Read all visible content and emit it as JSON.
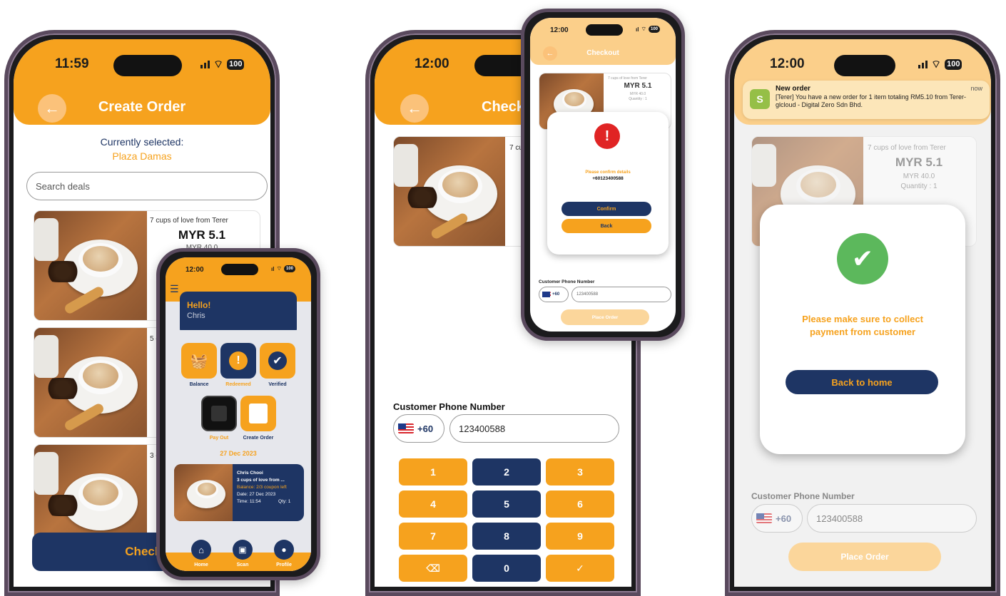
{
  "phone1": {
    "time": "11:59",
    "battery": "100",
    "title": "Create Order",
    "selected_label": "Currently selected:",
    "selected_value": "Plaza Damas",
    "search_placeholder": "Search deals",
    "deals": [
      {
        "name": "7 cups of love from Terer",
        "price": "MYR 5.1",
        "original": "MYR 40.0"
      },
      {
        "name": "5 c",
        "price": "",
        "original": ""
      },
      {
        "name": "3 c",
        "price": "",
        "original": ""
      }
    ],
    "checkout_label": "Checko"
  },
  "phone_small": {
    "time": "12:00",
    "battery": "100",
    "greeting": "Hello!",
    "user": "Chris",
    "tiles": [
      "Balance",
      "Redeemed",
      "Verified",
      "Pay Out",
      "Create Order"
    ],
    "date": "27 Dec 2023",
    "recent": {
      "name": "Chris Chooi",
      "deal": "3 cups of love from ...",
      "balance": "Balance: 2/3 coupon left",
      "date": "Date: 27 Dec 2023",
      "time": "Time: 11:54",
      "qty": "Qty: 1"
    },
    "nav": [
      "Home",
      "Scan",
      "Profile"
    ]
  },
  "phone2": {
    "time": "12:00",
    "title": "Checko",
    "deal_name": "7 cu",
    "phone_label": "Customer Phone Number",
    "country_code": "+60",
    "phone_value": "123400588",
    "keys": [
      "1",
      "2",
      "3",
      "4",
      "5",
      "6",
      "7",
      "8",
      "9",
      "⌫",
      "0",
      "✓"
    ]
  },
  "phone2_overlay": {
    "time": "12:00",
    "battery": "100",
    "title": "Checkout",
    "deal_name": "7 cups of love from Terer",
    "price": "MYR 5.1",
    "original": "MYR 40.0",
    "quantity": "Quantity : 1",
    "confirm_text": "Please confirm details",
    "confirm_number": "+60123400588",
    "confirm_button": "Confirm",
    "back_button": "Back",
    "phone_label": "Customer Phone Number",
    "country_code": "+60",
    "phone_value": "123400588",
    "place_order": "Place Order"
  },
  "phone3": {
    "time": "12:00",
    "battery": "100",
    "notification": {
      "title": "New order",
      "time": "now",
      "body": "[Terer] You have a new order for 1 item totaling RM5.10 from Terer-glcloud - Digital Zero Sdn Bhd."
    },
    "deal_name": "7 cups of love from Terer",
    "price": "MYR 5.1",
    "original": "MYR 40.0",
    "quantity": "Quantity : 1",
    "success_message": "Please make sure to collect payment from customer",
    "back_home": "Back to home",
    "phone_label": "Customer Phone Number",
    "country_code": "+60",
    "phone_value": "123400588",
    "place_order": "Place Order"
  },
  "colors": {
    "orange": "#f6a21e",
    "navy": "#1e3564",
    "success": "#5cb85c",
    "danger": "#e02424"
  }
}
